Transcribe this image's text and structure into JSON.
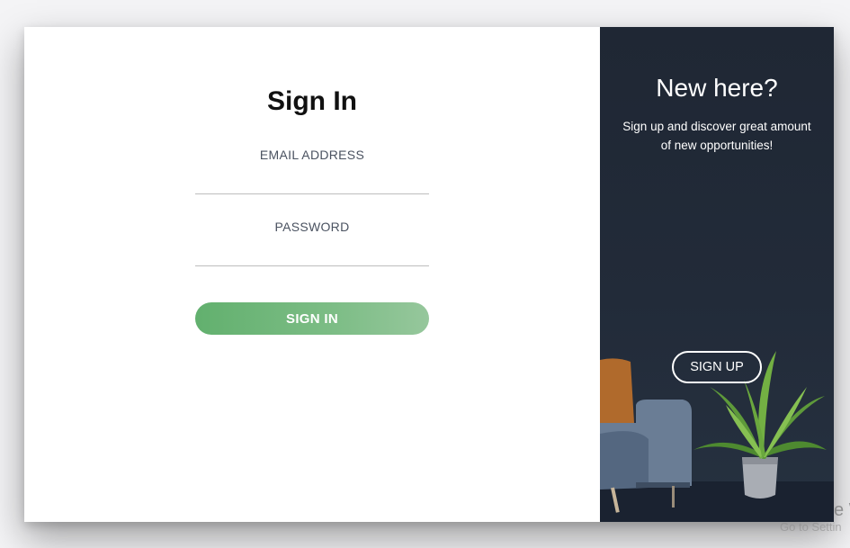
{
  "signin": {
    "title": "Sign In",
    "email_label": "EMAIL ADDRESS",
    "email_value": "",
    "password_label": "PASSWORD",
    "password_value": "",
    "button_label": "SIGN IN"
  },
  "signup": {
    "title": "New here?",
    "text": "Sign up and discover great amount of new opportunities!",
    "button_label": "SIGN UP",
    "background_image": "living-room-interior-with-sofa-and-plant"
  },
  "overlay": {
    "activate_text": "Activate W",
    "settings_text": "Go to Settin"
  },
  "colors": {
    "accent_green": "#62b06e",
    "panel_dark": "#1f2734",
    "white": "#ffffff"
  }
}
